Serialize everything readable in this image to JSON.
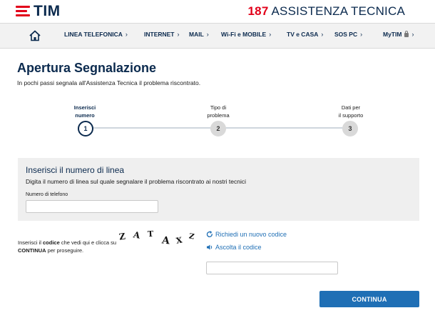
{
  "header": {
    "logo_text": "TIM",
    "assist_number": "187",
    "assist_label": "ASSISTENZA TECNICA",
    "brand_red": "#e2001a",
    "brand_blue": "#0b2a4e"
  },
  "nav": {
    "home_icon": "home-icon",
    "items": [
      {
        "label": "LINEA TELEFONICA",
        "chevron": "›"
      },
      {
        "label": "INTERNET",
        "chevron": "›"
      },
      {
        "label": "MAIL",
        "chevron": "›"
      },
      {
        "label": "Wi-Fi e MOBILE",
        "chevron": "›"
      },
      {
        "label": "TV e CASA",
        "chevron": "›"
      },
      {
        "label": "SOS PC",
        "chevron": "›"
      },
      {
        "label": "MyTIM",
        "chevron": "›"
      }
    ]
  },
  "page": {
    "title": "Apertura Segnalazione",
    "subtitle": "In pochi passi segnala all'Assistenza Tecnica il problema riscontrato."
  },
  "stepper": {
    "current": 1,
    "steps": [
      {
        "line1": "Inserisci",
        "line2": "numero",
        "number": "1"
      },
      {
        "line1": "Tipo di",
        "line2": "problema",
        "number": "2"
      },
      {
        "line1": "Dati per",
        "line2": "il supporto",
        "number": "3"
      }
    ]
  },
  "line_form": {
    "title": "Inserisci il numero di linea",
    "description": "Digita il numero di linea sul quale segnalare il problema riscontrato ai nostri tecnici",
    "phone_label": "Numero di telefono",
    "phone_value": "",
    "phone_placeholder": ""
  },
  "captcha": {
    "instr_a": "Inserisci il ",
    "instr_bold1": "codice",
    "instr_b": " che vedi qui e clicca su ",
    "instr_bold2": "CONTINUA",
    "instr_c": " per proseguire.",
    "chars": [
      "Z",
      "A",
      "T",
      "A",
      "X",
      "Z"
    ],
    "refresh_label": "Richiedi un nuovo codice",
    "refresh_icon": "refresh-icon",
    "audio_label": "Ascolta il codice",
    "audio_icon": "speaker-icon",
    "code_value": "",
    "link_color": "#1f6fb5"
  },
  "actions": {
    "continue_label": "CONTINUA"
  }
}
